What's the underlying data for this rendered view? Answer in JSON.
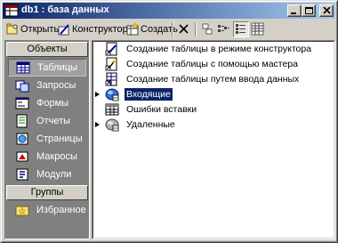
{
  "window": {
    "title": "db1 : база данных",
    "controls": {
      "minimize": "minimize",
      "maximize": "maximize",
      "close": "close"
    }
  },
  "toolbar": {
    "open_label": "Открыть",
    "design_label": "Конструктор",
    "create_label": "Создать"
  },
  "sidebar": {
    "objects_header": "Объекты",
    "items": [
      {
        "label": "Таблицы",
        "icon": "table-icon"
      },
      {
        "label": "Запросы",
        "icon": "query-icon"
      },
      {
        "label": "Формы",
        "icon": "form-icon"
      },
      {
        "label": "Отчеты",
        "icon": "report-icon"
      },
      {
        "label": "Страницы",
        "icon": "page-icon"
      },
      {
        "label": "Макросы",
        "icon": "macro-icon"
      },
      {
        "label": "Модули",
        "icon": "module-icon"
      }
    ],
    "selected_item": "Таблицы",
    "groups_header": "Группы",
    "favorites_label": "Избранное"
  },
  "objects": [
    {
      "label": "Создание таблицы в режиме конструктора",
      "icon": "design-shortcut-icon"
    },
    {
      "label": "Создание таблицы с помощью мастера",
      "icon": "wizard-shortcut-icon"
    },
    {
      "label": "Создание таблицы путем ввода данных",
      "icon": "datasheet-shortcut-icon"
    },
    {
      "label": "Входящие",
      "icon": "linked-table-icon",
      "selected": true
    },
    {
      "label": "Ошибки вставки",
      "icon": "table-icon"
    },
    {
      "label": "Удаленные",
      "icon": "linked-table-icon"
    }
  ],
  "colors": {
    "titlebar_start": "#0a246a",
    "titlebar_end": "#a6caf0",
    "selection": "#0a246a",
    "face": "#d4d0c8",
    "pane_dark": "#808080"
  }
}
